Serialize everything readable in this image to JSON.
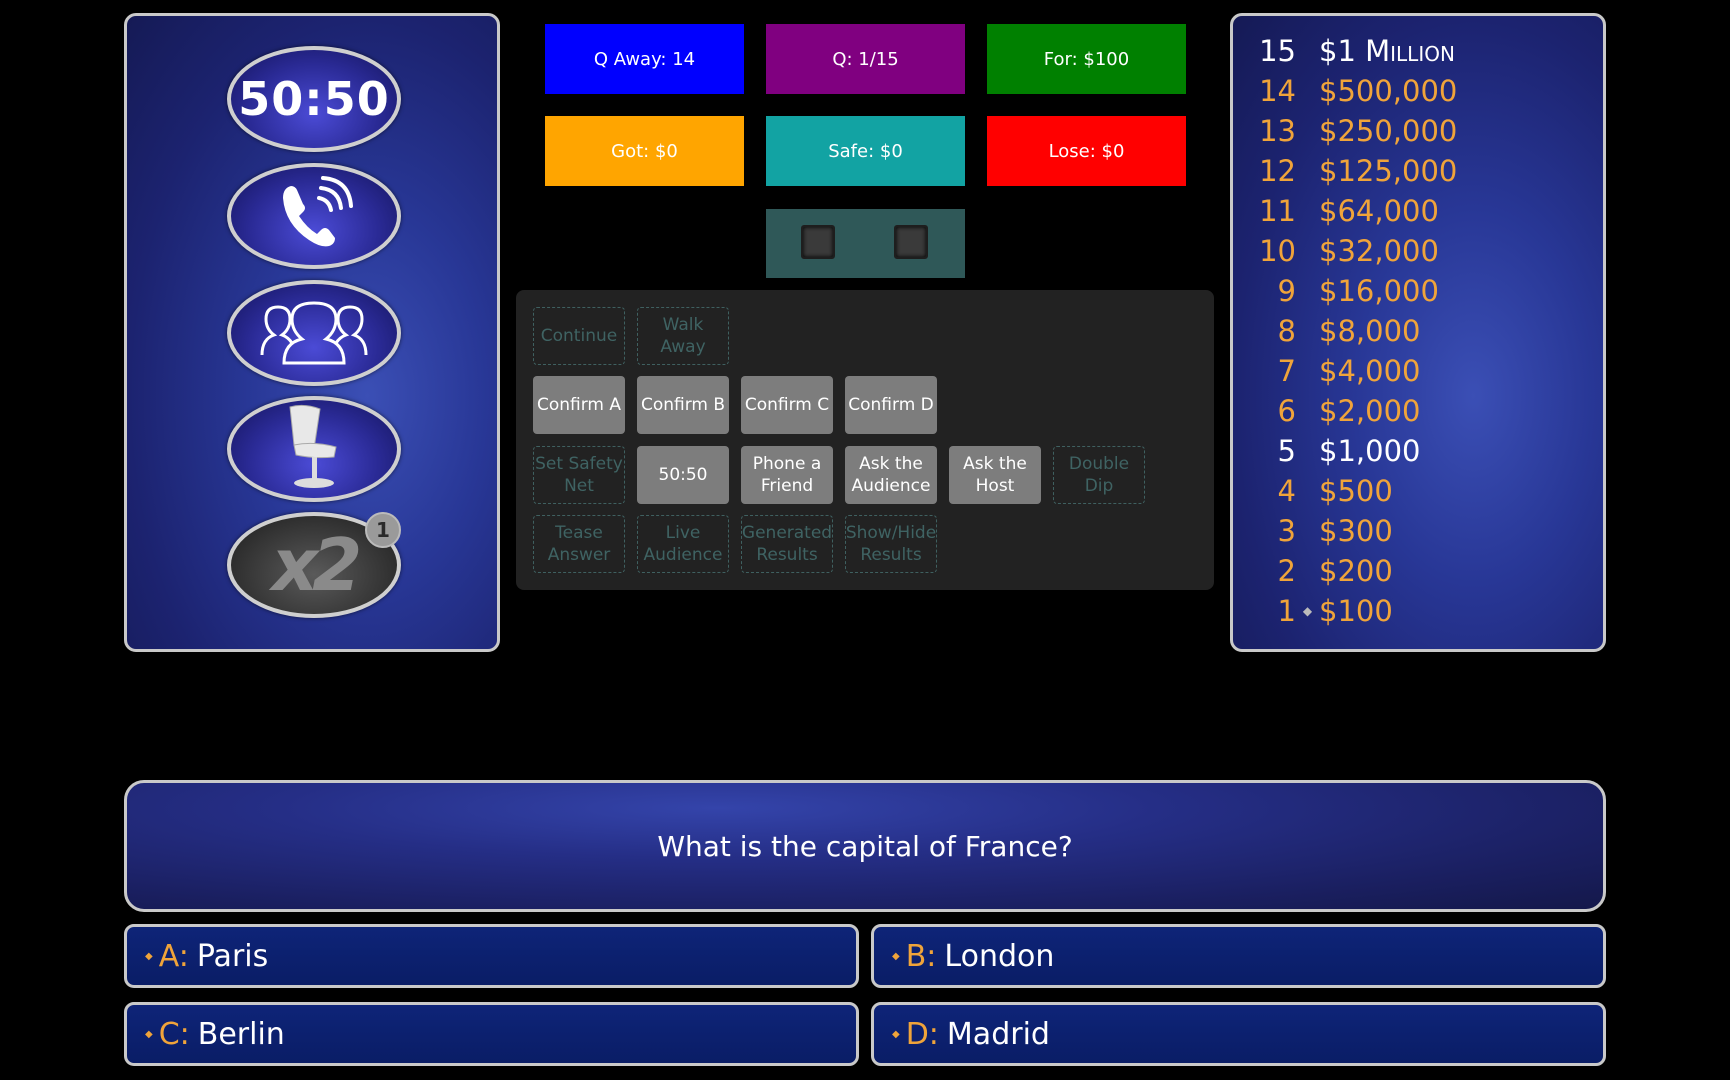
{
  "stats": {
    "q_away": "Q Away: 14",
    "q": "Q: 1/15",
    "for": "For: $100",
    "got": "Got: $0",
    "safe": "Safe: $0",
    "lose": "Lose: $0"
  },
  "colors": {
    "q_away": "#0000ff",
    "q": "#800080",
    "for": "#008000",
    "got": "#ffa500",
    "safe": "#12a3a3",
    "lose": "#ff0000"
  },
  "lifelines": {
    "fifty_fifty": "50:50",
    "phone_icon": "phone-icon",
    "audience_icon": "audience-icon",
    "host_icon": "chair-icon",
    "double_dip": "x2",
    "double_dip_count": "1"
  },
  "controls": {
    "continue": "Continue",
    "walk_away": "Walk Away",
    "confirm_a": "Confirm A",
    "confirm_b": "Confirm B",
    "confirm_c": "Confirm C",
    "confirm_d": "Confirm D",
    "set_safety_net": "Set Safety Net",
    "fifty_fifty": "50:50",
    "phone_a_friend": "Phone a Friend",
    "ask_the_audience": "Ask the Audience",
    "ask_the_host": "Ask the Host",
    "double_dip": "Double Dip",
    "tease_answer": "Tease Answer",
    "live_audience": "Live Audience",
    "generated_results": "Generated Results",
    "show_hide_results": "Show/Hide Results"
  },
  "ladder": [
    {
      "num": "15",
      "amount": "$1 Million"
    },
    {
      "num": "14",
      "amount": "$500,000"
    },
    {
      "num": "13",
      "amount": "$250,000"
    },
    {
      "num": "12",
      "amount": "$125,000"
    },
    {
      "num": "11",
      "amount": "$64,000"
    },
    {
      "num": "10",
      "amount": "$32,000"
    },
    {
      "num": "9",
      "amount": "$16,000"
    },
    {
      "num": "8",
      "amount": "$8,000"
    },
    {
      "num": "7",
      "amount": "$4,000"
    },
    {
      "num": "6",
      "amount": "$2,000"
    },
    {
      "num": "5",
      "amount": "$1,000"
    },
    {
      "num": "4",
      "amount": "$500"
    },
    {
      "num": "3",
      "amount": "$300"
    },
    {
      "num": "2",
      "amount": "$200"
    },
    {
      "num": "1",
      "amount": "$100"
    }
  ],
  "question": "What is the capital of France?",
  "answers": {
    "a_letter": "A:",
    "a_text": "Paris",
    "b_letter": "B:",
    "b_text": "London",
    "c_letter": "C:",
    "c_text": "Berlin",
    "d_letter": "D:",
    "d_text": "Madrid"
  }
}
